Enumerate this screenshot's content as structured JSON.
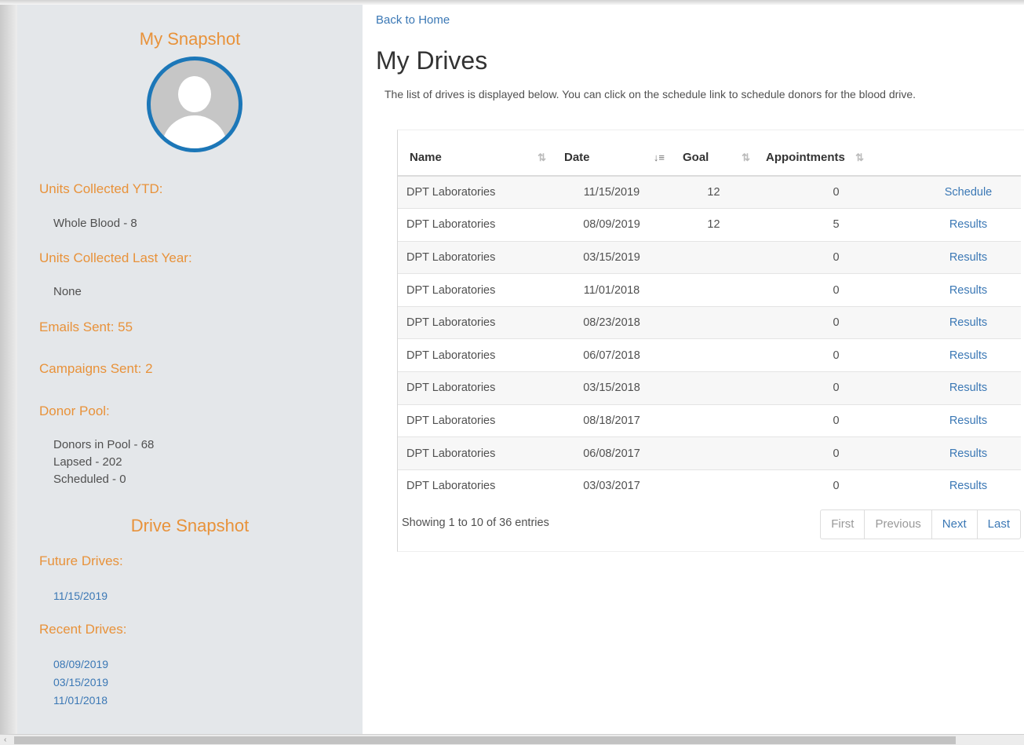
{
  "sidebar": {
    "my_snapshot_title": "My Snapshot",
    "units_ytd_heading": "Units Collected YTD:",
    "units_ytd_value": "Whole Blood - 8",
    "units_last_year_heading": "Units Collected Last Year:",
    "units_last_year_value": "None",
    "emails_sent": "Emails Sent: 55",
    "campaigns_sent": "Campaigns Sent: 2",
    "donor_pool_heading": "Donor Pool:",
    "donors_in_pool": "Donors in Pool - 68",
    "lapsed": "Lapsed - 202",
    "scheduled": "Scheduled - 0",
    "drive_snapshot_title": "Drive Snapshot",
    "future_drives_heading": "Future Drives:",
    "future_drives": [
      "11/15/2019"
    ],
    "recent_drives_heading": "Recent Drives:",
    "recent_drives": [
      "08/09/2019",
      "03/15/2019",
      "11/01/2018"
    ]
  },
  "main": {
    "back_link": "Back to Home",
    "title": "My Drives",
    "description": "The list of drives is displayed below. You can click on the schedule link to schedule donors for the blood drive.",
    "columns": [
      "Name",
      "Date",
      "Goal",
      "Appointments"
    ],
    "rows": [
      {
        "name": "DPT Laboratories",
        "date": "11/15/2019",
        "goal": "12",
        "appointments": "0",
        "action": "Schedule"
      },
      {
        "name": "DPT Laboratories",
        "date": "08/09/2019",
        "goal": "12",
        "appointments": "5",
        "action": "Results"
      },
      {
        "name": "DPT Laboratories",
        "date": "03/15/2019",
        "goal": "",
        "appointments": "0",
        "action": "Results"
      },
      {
        "name": "DPT Laboratories",
        "date": "11/01/2018",
        "goal": "",
        "appointments": "0",
        "action": "Results"
      },
      {
        "name": "DPT Laboratories",
        "date": "08/23/2018",
        "goal": "",
        "appointments": "0",
        "action": "Results"
      },
      {
        "name": "DPT Laboratories",
        "date": "06/07/2018",
        "goal": "",
        "appointments": "0",
        "action": "Results"
      },
      {
        "name": "DPT Laboratories",
        "date": "03/15/2018",
        "goal": "",
        "appointments": "0",
        "action": "Results"
      },
      {
        "name": "DPT Laboratories",
        "date": "08/18/2017",
        "goal": "",
        "appointments": "0",
        "action": "Results"
      },
      {
        "name": "DPT Laboratories",
        "date": "06/08/2017",
        "goal": "",
        "appointments": "0",
        "action": "Results"
      },
      {
        "name": "DPT Laboratories",
        "date": "03/03/2017",
        "goal": "",
        "appointments": "0",
        "action": "Results"
      }
    ],
    "info": "Showing 1 to 10 of 36 entries",
    "pagination": {
      "first": "First",
      "previous": "Previous",
      "next": "Next",
      "last": "Last"
    }
  },
  "icons": {
    "sort": "sort-icon",
    "sort_desc": "sort-desc-icon",
    "avatar": "avatar-icon",
    "scroll_left": "scroll-left-arrow-icon"
  },
  "colors": {
    "accent": "#e8923a",
    "link": "#3b78b5",
    "avatar_ring": "#1c77b8",
    "sidebar_bg": "#e4e7ea"
  }
}
